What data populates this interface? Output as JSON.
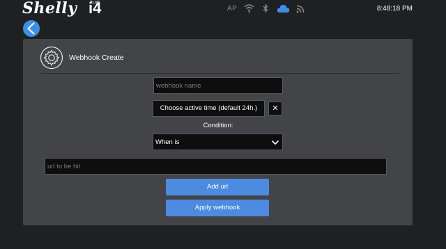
{
  "app": {
    "logo_main": "Shelly",
    "logo_plus": "PLUS",
    "logo_model": "i4"
  },
  "status_bar": {
    "ap_label": "AP",
    "icons": [
      "wifi-icon",
      "bluetooth-icon",
      "cloud-icon",
      "rss-icon"
    ],
    "cloud_color": "#3d8fe6",
    "clock": "8:48:18 PM"
  },
  "colors": {
    "accent": "#4d8be0",
    "back_button": "#3d8fe6",
    "panel": "#434447",
    "background": "#1f2022"
  },
  "panel": {
    "icon": "gear-icon",
    "title": "Webhook Create"
  },
  "form": {
    "name_placeholder": "webhook name",
    "name_value": "",
    "active_time_label": "Choose active time (default 24h.)",
    "clear_label": "✕",
    "condition_label": "Condition:",
    "condition_selected": "When is",
    "url_placeholder": "url to be hit",
    "url_value": "",
    "add_url_label": "Add url",
    "apply_label": "Apply webhook"
  }
}
